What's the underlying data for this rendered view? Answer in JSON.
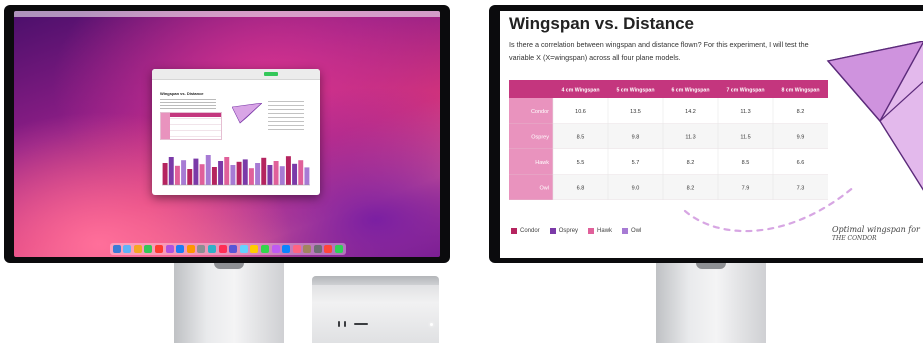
{
  "left_display": {
    "document": {
      "title": "Wingspan vs. Distance",
      "bar_heights": [
        0.55,
        0.7,
        0.48,
        0.62,
        0.4,
        0.66,
        0.52,
        0.75,
        0.45,
        0.6,
        0.7,
        0.5,
        0.58,
        0.64,
        0.42,
        0.55,
        0.68,
        0.5,
        0.6,
        0.47,
        0.72,
        0.53,
        0.62,
        0.44
      ]
    },
    "dock_colors": [
      "#3a7bd5",
      "#5fb3f7",
      "#f5a623",
      "#34c759",
      "#ff3b30",
      "#af52de",
      "#1c7cf4",
      "#ff9500",
      "#8e8e93",
      "#30b0c7",
      "#ff2d55",
      "#5856d6",
      "#64d2ff",
      "#ffcc00",
      "#32d74b",
      "#bf5af2",
      "#0a84ff",
      "#ff6482",
      "#a2845e",
      "#6e6e73",
      "#ff453a",
      "#30d158"
    ]
  },
  "right_display": {
    "title": "Wingspan vs. Distance",
    "body": "Is there a correlation between wingspan and distance flown? For this experiment, I will test the variable X (X=wingspan) across all four plane models.",
    "table": {
      "columns": [
        "",
        "4 cm Wingspan",
        "5 cm Wingspan",
        "6 cm Wingspan",
        "7 cm Wingspan",
        "8 cm Wingspan"
      ],
      "rows": [
        {
          "name": "Condor",
          "values": [
            "10.6",
            "13.5",
            "14.2",
            "11.3",
            "8.2"
          ]
        },
        {
          "name": "Osprey",
          "values": [
            "8.5",
            "9.8",
            "11.3",
            "11.5",
            "9.9"
          ]
        },
        {
          "name": "Hawk",
          "values": [
            "5.5",
            "5.7",
            "8.2",
            "8.5",
            "6.6"
          ]
        },
        {
          "name": "Owl",
          "values": [
            "6.8",
            "9.0",
            "8.2",
            "7.9",
            "7.3"
          ]
        }
      ]
    },
    "legend": [
      {
        "label": "Condor",
        "color": "#b5245f"
      },
      {
        "label": "Osprey",
        "color": "#7b3aa8"
      },
      {
        "label": "Hawk",
        "color": "#e0609a"
      },
      {
        "label": "Owl",
        "color": "#a77bd4"
      }
    ],
    "note_line1": "Optimal wingspan for",
    "note_line2": "THE CONDOR"
  }
}
